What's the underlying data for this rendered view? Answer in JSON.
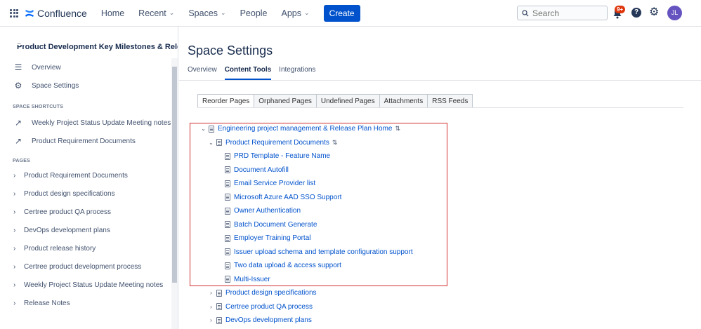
{
  "topnav": {
    "logo_text": "Confluence",
    "home": "Home",
    "recent": "Recent",
    "spaces": "Spaces",
    "people": "People",
    "apps": "Apps",
    "create": "Create",
    "search_placeholder": "Search",
    "notifications_badge": "9+",
    "help": "?",
    "avatar_initials": "JL"
  },
  "sidebar": {
    "space_title": "Product Development Key Milestones & Rele...",
    "links": [
      {
        "label": "Overview",
        "icon": "overview-icon"
      },
      {
        "label": "Space Settings",
        "icon": "gear-icon"
      }
    ],
    "shortcuts_heading": "SPACE SHORTCUTS",
    "shortcuts": [
      {
        "label": "Weekly Project Status Update Meeting notes"
      },
      {
        "label": "Product Requirement Documents"
      }
    ],
    "pages_heading": "PAGES",
    "pages": [
      {
        "label": "Product Requirement Documents"
      },
      {
        "label": "Product design specifications"
      },
      {
        "label": "Certree product QA process"
      },
      {
        "label": "DevOps development plans"
      },
      {
        "label": "Product release history"
      },
      {
        "label": "Certree product development process"
      },
      {
        "label": "Weekly Project Status Update Meeting notes"
      },
      {
        "label": "Release Notes"
      }
    ]
  },
  "main": {
    "title": "Space Settings",
    "tabs": [
      {
        "label": "Overview",
        "active": false
      },
      {
        "label": "Content Tools",
        "active": true
      },
      {
        "label": "Integrations",
        "active": false
      }
    ],
    "subtabs": [
      {
        "label": "Reorder Pages",
        "active": true
      },
      {
        "label": "Orphaned Pages",
        "active": false
      },
      {
        "label": "Undefined Pages",
        "active": false
      },
      {
        "label": "Attachments",
        "active": false
      },
      {
        "label": "RSS Feeds",
        "active": false
      }
    ],
    "tree": {
      "root": "Engineering project management & Release Plan Home",
      "child": "Product Requirement Documents",
      "grandchildren": [
        "PRD Template - Feature Name",
        "Document Autofill",
        "Email Service Provider list",
        "Microsoft Azure AAD SSO Support",
        "Owner Authentication",
        "Batch Document Generate",
        "Employer Training Portal",
        "Issuer upload schema and template configuration support",
        "Two data upload & access support",
        "Multi-Issuer"
      ],
      "siblings": [
        "Product design specifications",
        "Certree product QA process",
        "DevOps development plans"
      ]
    },
    "highlight_color": "#d32f2f"
  }
}
